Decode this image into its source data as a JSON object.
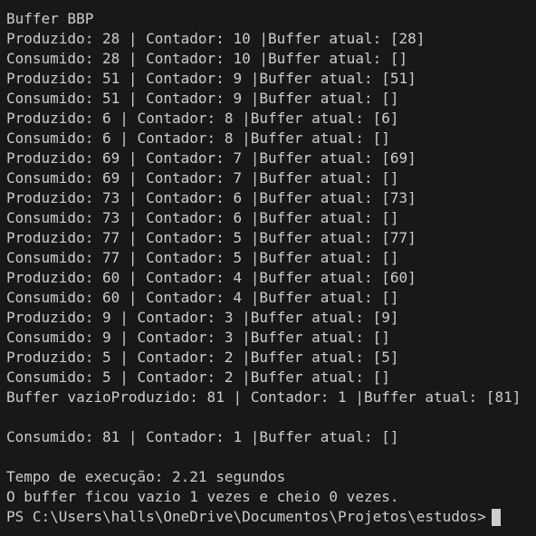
{
  "terminal": {
    "lines": [
      "Buffer BBP",
      "Produzido: 28 | Contador: 10 |Buffer atual: [28]",
      "Consumido: 28 | Contador: 10 |Buffer atual: []",
      "Produzido: 51 | Contador: 9 |Buffer atual: [51]",
      "Consumido: 51 | Contador: 9 |Buffer atual: []",
      "Produzido: 6 | Contador: 8 |Buffer atual: [6]",
      "Consumido: 6 | Contador: 8 |Buffer atual: []",
      "Produzido: 69 | Contador: 7 |Buffer atual: [69]",
      "Consumido: 69 | Contador: 7 |Buffer atual: []",
      "Produzido: 73 | Contador: 6 |Buffer atual: [73]",
      "Consumido: 73 | Contador: 6 |Buffer atual: []",
      "Produzido: 77 | Contador: 5 |Buffer atual: [77]",
      "Consumido: 77 | Contador: 5 |Buffer atual: []",
      "Produzido: 60 | Contador: 4 |Buffer atual: [60]",
      "Consumido: 60 | Contador: 4 |Buffer atual: []",
      "Produzido: 9 | Contador: 3 |Buffer atual: [9]",
      "Consumido: 9 | Contador: 3 |Buffer atual: []",
      "Produzido: 5 | Contador: 2 |Buffer atual: [5]",
      "Consumido: 5 | Contador: 2 |Buffer atual: []",
      "Buffer vazioProduzido: 81 | Contador: 1 |Buffer atual: [81]",
      "",
      "Consumido: 81 | Contador: 1 |Buffer atual: []",
      "",
      "Tempo de execução: 2.21 segundos",
      "O buffer ficou vazio 1 vezes e cheio 0 vezes."
    ],
    "prompt": "PS C:\\Users\\halls\\OneDrive\\Documentos\\Projetos\\estudos>"
  },
  "colors": {
    "background": "#181818",
    "text": "#cccccc",
    "cursor": "#cccccc"
  }
}
